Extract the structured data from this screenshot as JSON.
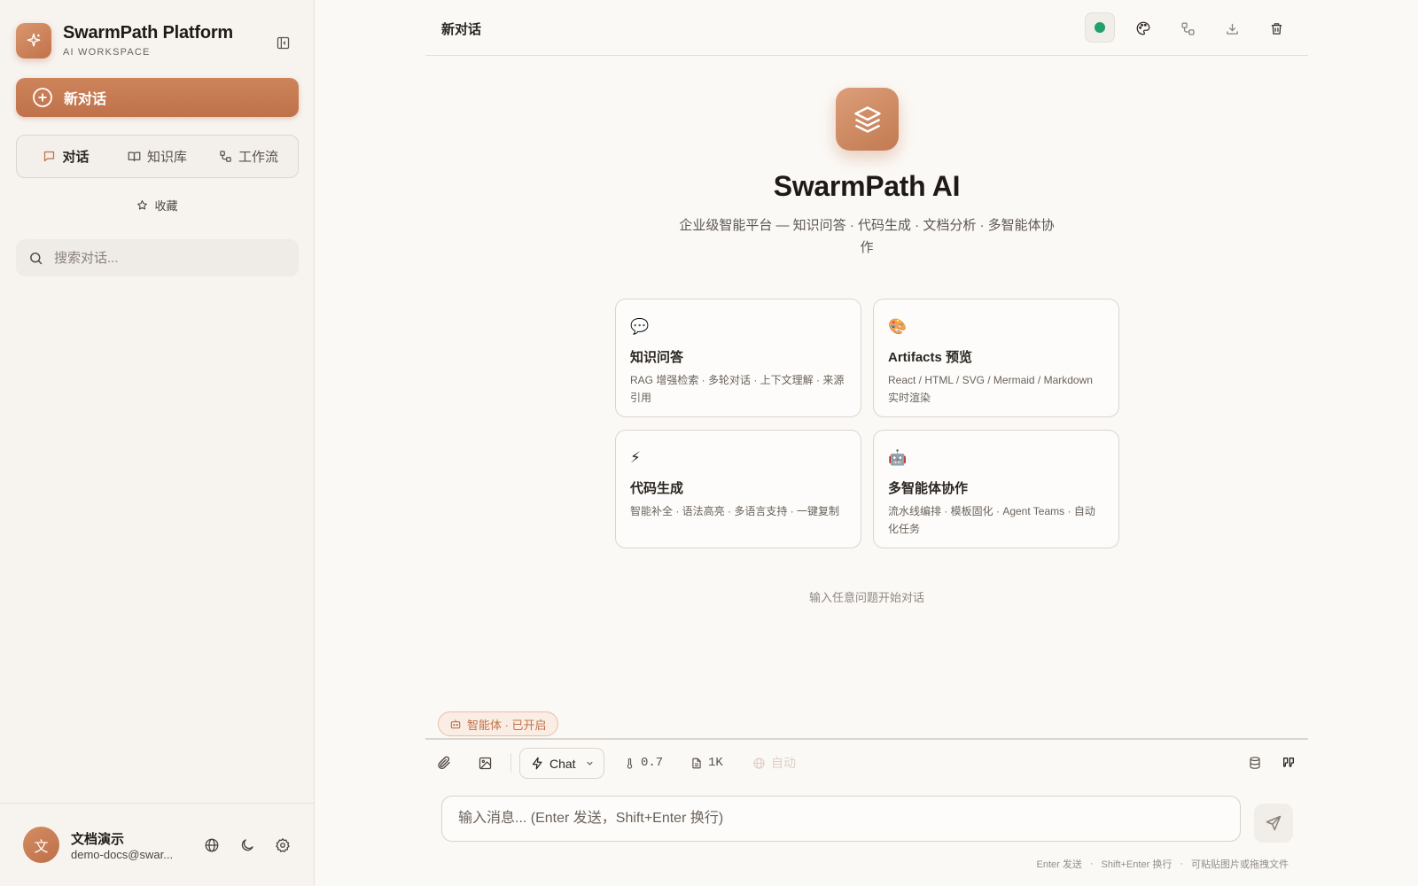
{
  "colors": {
    "accent": "#c57a51",
    "background": "#fbf9f6",
    "sidebar": "#f7f4f0",
    "status_online": "#22a06b"
  },
  "sidebar": {
    "brand_title": "SwarmPath Platform",
    "brand_subtitle": "AI WORKSPACE",
    "new_chat_label": "新对话",
    "tabs": [
      {
        "label": "对话",
        "icon": "message-icon",
        "active": true
      },
      {
        "label": "知识库",
        "icon": "book-icon",
        "active": false
      },
      {
        "label": "工作流",
        "icon": "workflow-icon",
        "active": false
      }
    ],
    "favorites_label": "收藏",
    "search_placeholder": "搜索对话...",
    "user": {
      "avatar_initial": "文",
      "name": "文档演示",
      "email": "demo-docs@swar..."
    }
  },
  "header": {
    "title": "新对话",
    "actions": [
      "status-indicator",
      "palette-icon",
      "workflow-icon",
      "download-icon",
      "trash-icon"
    ]
  },
  "hero": {
    "title": "SwarmPath AI",
    "subtitle": "企业级智能平台 — 知识问答 · 代码生成 · 文档分析 · 多智能体协作"
  },
  "cards": [
    {
      "icon": "speech-bubble-icon",
      "emoji": "💬",
      "title": "知识问答",
      "desc": "RAG 增强检索 · 多轮对话 · 上下文理解 · 来源引用"
    },
    {
      "icon": "palette-icon",
      "emoji": "🎨",
      "title": "Artifacts 预览",
      "desc": "React / HTML / SVG / Mermaid / Markdown 实时渲染"
    },
    {
      "icon": "lightning-icon",
      "emoji": "⚡",
      "title": "代码生成",
      "desc": "智能补全 · 语法高亮 · 多语言支持 · 一键复制"
    },
    {
      "icon": "robot-icon",
      "emoji": "🤖",
      "title": "多智能体协作",
      "desc": "流水线编排 · 模板固化 · Agent Teams · 自动化任务"
    }
  ],
  "start_hint": "输入任意问题开始对话",
  "composer": {
    "agent_badge": "智能体 · 已开启",
    "model": "Chat",
    "temperature": "0.7",
    "max_tokens": "1K",
    "web_mode": "自动",
    "input_placeholder": "输入消息... (Enter 发送，Shift+Enter 换行)",
    "footer_hints": [
      "Enter 发送",
      "Shift+Enter 换行",
      "可粘贴图片或拖拽文件"
    ]
  }
}
